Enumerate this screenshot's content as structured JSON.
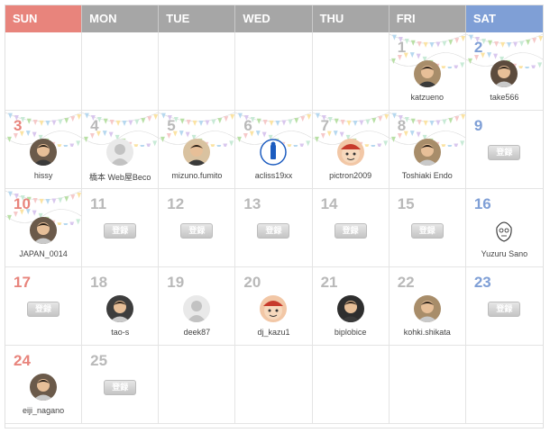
{
  "weekdays": [
    "SUN",
    "MON",
    "TUE",
    "WED",
    "THU",
    "FRI",
    "SAT"
  ],
  "register_label": "登録",
  "colors": {
    "sun": "#e8847c",
    "sat": "#7f9fd6",
    "weekday_header": "#a6a6a6"
  },
  "weeks": [
    [
      {
        "day": ""
      },
      {
        "day": ""
      },
      {
        "day": ""
      },
      {
        "day": ""
      },
      {
        "day": ""
      },
      {
        "day": "1",
        "user": "katzueno",
        "avatar": "person-photo-icon",
        "bunting": true
      },
      {
        "day": "2",
        "user": "take566",
        "avatar": "person-photo-icon",
        "bunting": true
      }
    ],
    [
      {
        "day": "3",
        "user": "hissy",
        "avatar": "person-photo-icon",
        "bunting": true
      },
      {
        "day": "4",
        "user": "橋本 Web屋Beco",
        "avatar": "default-avatar-icon",
        "bunting": true
      },
      {
        "day": "5",
        "user": "mizuno.fumito",
        "avatar": "person-photo-icon",
        "bunting": true
      },
      {
        "day": "6",
        "user": "acliss19xx",
        "avatar": "blue-logo-icon",
        "bunting": true
      },
      {
        "day": "7",
        "user": "pictron2009",
        "avatar": "cartoon-face-icon",
        "bunting": true
      },
      {
        "day": "8",
        "user": "Toshiaki Endo",
        "avatar": "person-photo-icon",
        "bunting": true
      },
      {
        "day": "9",
        "register": true
      }
    ],
    [
      {
        "day": "10",
        "user": "JAPAN_0014",
        "avatar": "person-photo-icon",
        "bunting": true
      },
      {
        "day": "11",
        "register": true
      },
      {
        "day": "12",
        "register": true
      },
      {
        "day": "13",
        "register": true
      },
      {
        "day": "14",
        "register": true
      },
      {
        "day": "15",
        "register": true
      },
      {
        "day": "16",
        "user": "Yuzuru Sano",
        "avatar": "sketch-face-icon"
      }
    ],
    [
      {
        "day": "17",
        "register": true
      },
      {
        "day": "18",
        "user": "tao-s",
        "avatar": "person-photo-icon"
      },
      {
        "day": "19",
        "user": "deek87",
        "avatar": "default-avatar-icon"
      },
      {
        "day": "20",
        "user": "dj_kazu1",
        "avatar": "cartoon-face-icon"
      },
      {
        "day": "21",
        "user": "biplobice",
        "avatar": "person-photo-icon"
      },
      {
        "day": "22",
        "user": "kohki.shikata",
        "avatar": "person-photo-icon"
      },
      {
        "day": "23",
        "register": true
      }
    ],
    [
      {
        "day": "24",
        "user": "eiji_nagano",
        "avatar": "person-photo-icon"
      },
      {
        "day": "25",
        "register": true
      },
      {
        "day": ""
      },
      {
        "day": ""
      },
      {
        "day": ""
      },
      {
        "day": ""
      },
      {
        "day": ""
      }
    ]
  ]
}
